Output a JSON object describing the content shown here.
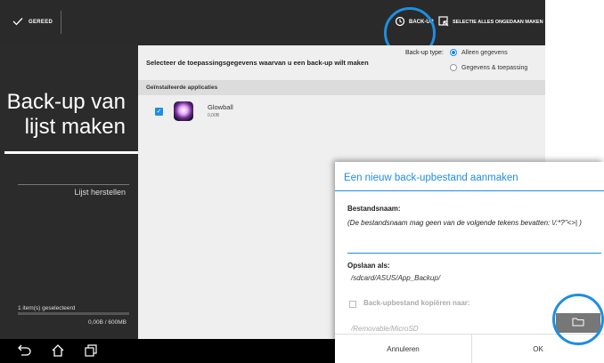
{
  "actionbar": {
    "gereed_label": "GEREED",
    "backup_label": "BACK-UP",
    "selectie_label": "SELECTIE ALLES ONGEDAAN MAKEN",
    "icons": [
      "check-icon",
      "backup-clock-icon",
      "selection-icon"
    ]
  },
  "sidebar": {
    "title": "Back-up van lijst maken",
    "lijst_herstellen": "Lijst herstellen",
    "selected_count": "1 item(s) geselecteerd",
    "size": "0,00B / 600MB",
    "progress": 0
  },
  "main": {
    "prompt": "Selecteer de toepassingsgegevens waarvan u een back-up wilt maken",
    "backup_type_label": "Back-up type:",
    "options": [
      {
        "label": "Alleen gegevens",
        "selected": true
      },
      {
        "label": "Gegevens & toepassing",
        "selected": false
      }
    ],
    "section_label": "Geïnstalleerde applicaties",
    "apps": [
      {
        "name": "Glowball",
        "size": "0,00B",
        "checked": true
      }
    ]
  },
  "dialog": {
    "title": "Een nieuw back-upbestand aanmaken",
    "filename_label": "Bestandsnaam:",
    "filename_hint": "(De bestandsnaam mag geen van de volgende tekens bevatten: \\/:*?\"<>| )",
    "filename_value": "",
    "save_label": "Opslaan als:",
    "save_path": "/sdcard/ASUS/App_Backup/",
    "copy_label": "Back-upbestand kopiëren naar:",
    "copy_path": "/Removable/MicroSD",
    "cancel_label": "Annuleren",
    "ok_label": "OK"
  },
  "colors": {
    "accent": "#1f8ee0",
    "dark_panel": "#2b2b2b",
    "actionbar": "#2a2a2a"
  }
}
